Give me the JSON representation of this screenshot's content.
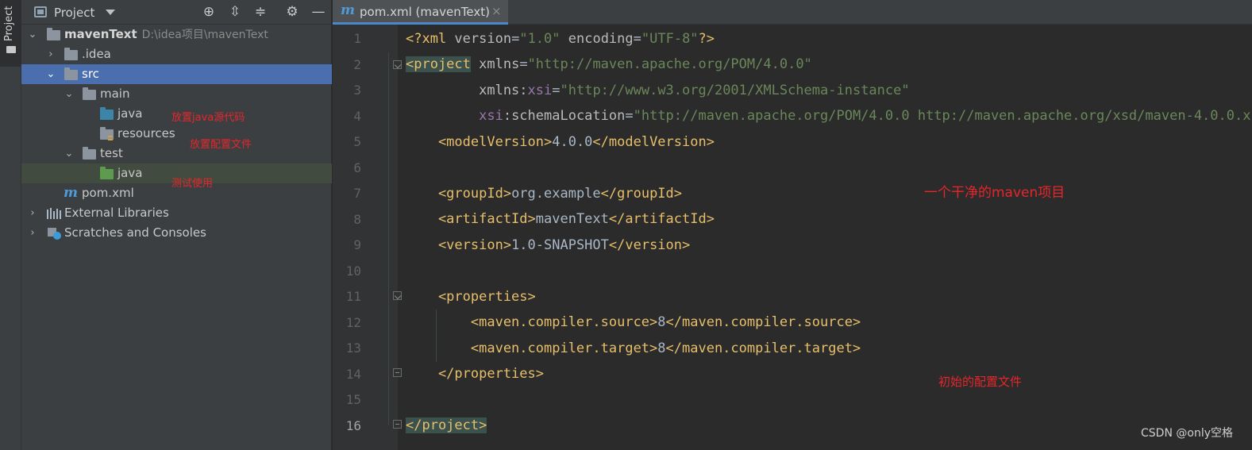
{
  "toolstrip": {
    "project_label": "Project"
  },
  "project_panel": {
    "title": "Project",
    "tree": [
      {
        "label": "mavenText",
        "path": "D:\\idea项目\\mavenText"
      },
      {
        "label": ".idea"
      },
      {
        "label": "src"
      },
      {
        "label": "main"
      },
      {
        "label": "java"
      },
      {
        "label": "resources"
      },
      {
        "label": "test"
      },
      {
        "label": "java"
      },
      {
        "label": "pom.xml"
      },
      {
        "label": "External Libraries"
      },
      {
        "label": "Scratches and Consoles"
      }
    ],
    "annotations": {
      "java_src": "放置java源代码",
      "resources": "放置配置文件",
      "test": "测试使用"
    }
  },
  "editor": {
    "tab_label": "pom.xml (mavenText)",
    "line_numbers": [
      "1",
      "2",
      "3",
      "4",
      "5",
      "6",
      "7",
      "8",
      "9",
      "10",
      "11",
      "12",
      "13",
      "14",
      "15",
      "16"
    ],
    "annotations": {
      "clean_project": "一个干净的maven项目",
      "initial_config": "初始的配置文件"
    }
  },
  "watermark": "CSDN @only空格",
  "colors": {
    "selection": "#4b6eaf",
    "tag": "#e8bf6a",
    "value": "#6a8759",
    "namespace": "#9876aa",
    "annotation": "#e5262b"
  }
}
